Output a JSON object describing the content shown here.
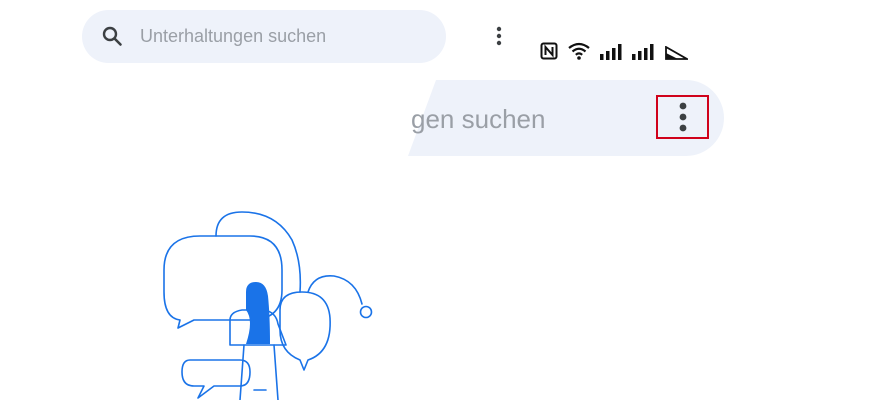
{
  "search_top": {
    "placeholder": "Unterhaltungen suchen",
    "search_icon": "search-icon",
    "more_icon": "more-vert-icon"
  },
  "status_bar": {
    "icons": [
      "nfc-icon",
      "wifi-icon",
      "signal-icon",
      "signal-icon",
      "battery-saver-icon"
    ]
  },
  "search_big": {
    "placeholder_visible": "gen suchen",
    "more_icon": "more-vert-icon",
    "highlight_color": "#d0021b"
  },
  "colors": {
    "search_bg": "#eef2fa",
    "placeholder": "#9a9fa6",
    "icon": "#3c4043",
    "illustration_line": "#1a73e8"
  },
  "illustration": {
    "name": "empty-conversations-illustration"
  }
}
